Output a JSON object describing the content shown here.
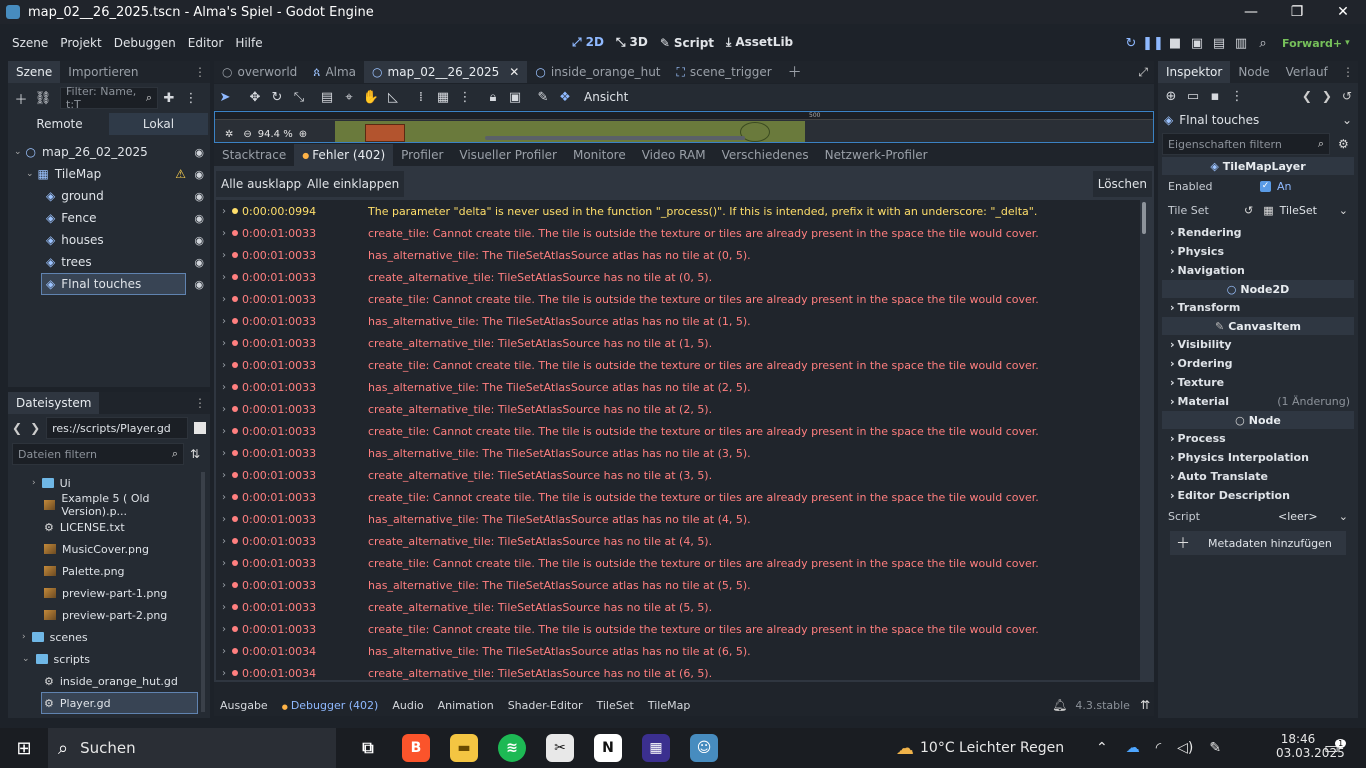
{
  "window": {
    "title": "map_02__26_2025.tscn - Alma's Spiel - Godot Engine"
  },
  "menu": [
    "Szene",
    "Projekt",
    "Debuggen",
    "Editor",
    "Hilfe"
  ],
  "workspaces": [
    "2D",
    "3D",
    "Script",
    "AssetLib"
  ],
  "renderer": "Forward+",
  "scene_dock": {
    "tabs": [
      "Szene",
      "Importieren"
    ],
    "filter_placeholder": "Filter: Name, t:T",
    "modes": [
      "Remote",
      "Lokal"
    ],
    "tree": [
      {
        "label": "map_26_02_2025",
        "depth": 0
      },
      {
        "label": "TileMap",
        "depth": 1
      },
      {
        "label": "ground",
        "depth": 2
      },
      {
        "label": "Fence",
        "depth": 2
      },
      {
        "label": "houses",
        "depth": 2
      },
      {
        "label": "trees",
        "depth": 2
      },
      {
        "label": "FInal touches",
        "depth": 2
      }
    ]
  },
  "filesystem": {
    "tab": "Dateisystem",
    "path": "res://scripts/Player.gd",
    "filter_placeholder": "Dateien filtern",
    "items": [
      "Ui",
      "Example 5 ( Old Version).p...",
      "LICENSE.txt",
      "MusicCover.png",
      "Palette.png",
      "preview-part-1.png",
      "preview-part-2.png",
      "scenes",
      "scripts",
      "inside_orange_hut.gd",
      "Player.gd"
    ]
  },
  "scene_tabs": [
    "overworld",
    "Alma",
    "map_02__26_2025",
    "inside_orange_hut",
    "scene_trigger"
  ],
  "viewport": {
    "view_label": "Ansicht",
    "zoom": "94.4 %",
    "ruler_mark": "500"
  },
  "debugger": {
    "tabs": [
      "Stacktrace",
      "Fehler (402)",
      "Profiler",
      "Visueller Profiler",
      "Monitore",
      "Video RAM",
      "Verschiedenes",
      "Netzwerk-Profiler"
    ],
    "expand_all": "Alle ausklappen",
    "collapse_all": "Alle einklappen",
    "clear": "Löschen",
    "rows": [
      {
        "time": "0:00:00:0994",
        "msg": "The parameter \"delta\" is never used in the function \"_process()\". If this is intended, prefix it with an underscore: \"_delta\".",
        "level": "warn"
      },
      {
        "time": "0:00:01:0033",
        "msg": "create_tile: Cannot create tile. The tile is outside the texture or tiles are already present in the space the tile would cover.",
        "level": "err"
      },
      {
        "time": "0:00:01:0033",
        "msg": "has_alternative_tile: The TileSetAtlasSource atlas has no tile at (0, 5).",
        "level": "err"
      },
      {
        "time": "0:00:01:0033",
        "msg": "create_alternative_tile: TileSetAtlasSource has no tile at (0, 5).",
        "level": "err"
      },
      {
        "time": "0:00:01:0033",
        "msg": "create_tile: Cannot create tile. The tile is outside the texture or tiles are already present in the space the tile would cover.",
        "level": "err"
      },
      {
        "time": "0:00:01:0033",
        "msg": "has_alternative_tile: The TileSetAtlasSource atlas has no tile at (1, 5).",
        "level": "err"
      },
      {
        "time": "0:00:01:0033",
        "msg": "create_alternative_tile: TileSetAtlasSource has no tile at (1, 5).",
        "level": "err"
      },
      {
        "time": "0:00:01:0033",
        "msg": "create_tile: Cannot create tile. The tile is outside the texture or tiles are already present in the space the tile would cover.",
        "level": "err"
      },
      {
        "time": "0:00:01:0033",
        "msg": "has_alternative_tile: The TileSetAtlasSource atlas has no tile at (2, 5).",
        "level": "err"
      },
      {
        "time": "0:00:01:0033",
        "msg": "create_alternative_tile: TileSetAtlasSource has no tile at (2, 5).",
        "level": "err"
      },
      {
        "time": "0:00:01:0033",
        "msg": "create_tile: Cannot create tile. The tile is outside the texture or tiles are already present in the space the tile would cover.",
        "level": "err"
      },
      {
        "time": "0:00:01:0033",
        "msg": "has_alternative_tile: The TileSetAtlasSource atlas has no tile at (3, 5).",
        "level": "err"
      },
      {
        "time": "0:00:01:0033",
        "msg": "create_alternative_tile: TileSetAtlasSource has no tile at (3, 5).",
        "level": "err"
      },
      {
        "time": "0:00:01:0033",
        "msg": "create_tile: Cannot create tile. The tile is outside the texture or tiles are already present in the space the tile would cover.",
        "level": "err"
      },
      {
        "time": "0:00:01:0033",
        "msg": "has_alternative_tile: The TileSetAtlasSource atlas has no tile at (4, 5).",
        "level": "err"
      },
      {
        "time": "0:00:01:0033",
        "msg": "create_alternative_tile: TileSetAtlasSource has no tile at (4, 5).",
        "level": "err"
      },
      {
        "time": "0:00:01:0033",
        "msg": "create_tile: Cannot create tile. The tile is outside the texture or tiles are already present in the space the tile would cover.",
        "level": "err"
      },
      {
        "time": "0:00:01:0033",
        "msg": "has_alternative_tile: The TileSetAtlasSource atlas has no tile at (5, 5).",
        "level": "err"
      },
      {
        "time": "0:00:01:0033",
        "msg": "create_alternative_tile: TileSetAtlasSource has no tile at (5, 5).",
        "level": "err"
      },
      {
        "time": "0:00:01:0033",
        "msg": "create_tile: Cannot create tile. The tile is outside the texture or tiles are already present in the space the tile would cover.",
        "level": "err"
      },
      {
        "time": "0:00:01:0034",
        "msg": "has_alternative_tile: The TileSetAtlasSource atlas has no tile at (6, 5).",
        "level": "err"
      },
      {
        "time": "0:00:01:0034",
        "msg": "create_alternative_tile: TileSetAtlasSource has no tile at (6, 5).",
        "level": "err"
      }
    ]
  },
  "bottom_panel": {
    "tabs": [
      "Ausgabe",
      "Debugger (402)",
      "Audio",
      "Animation",
      "Shader-Editor",
      "TileSet",
      "TileMap"
    ],
    "version": "4.3.stable"
  },
  "inspector": {
    "tabs": [
      "Inspektor",
      "Node",
      "Verlauf"
    ],
    "node_name": "FInal touches",
    "filter_placeholder": "Eigenschaften filtern",
    "class_tilemaplayer": "TileMapLayer",
    "enabled_label": "Enabled",
    "enabled_value": "An",
    "tileset_label": "Tile Set",
    "tileset_value": "TileSet",
    "sections_a": [
      "Rendering",
      "Physics",
      "Navigation"
    ],
    "class_node2d": "Node2D",
    "sections_b": [
      "Transform"
    ],
    "class_canvasitem": "CanvasItem",
    "sections_c": [
      "Visibility",
      "Ordering",
      "Texture",
      "Material"
    ],
    "material_note": "(1 Änderung)",
    "class_node": "Node",
    "sections_d": [
      "Process",
      "Physics Interpolation",
      "Auto Translate",
      "Editor Description"
    ],
    "script_label": "Script",
    "script_value": "<leer>",
    "add_metadata": "Metadaten hinzufügen"
  },
  "taskbar": {
    "search": "Suchen",
    "weather": "10°C  Leichter Regen",
    "time": "18:46",
    "date": "03.03.2025",
    "notifications": "1"
  },
  "colors": {
    "accent": "#478cbf",
    "error": "#ff7f7f",
    "warning": "#ffdf6b"
  }
}
